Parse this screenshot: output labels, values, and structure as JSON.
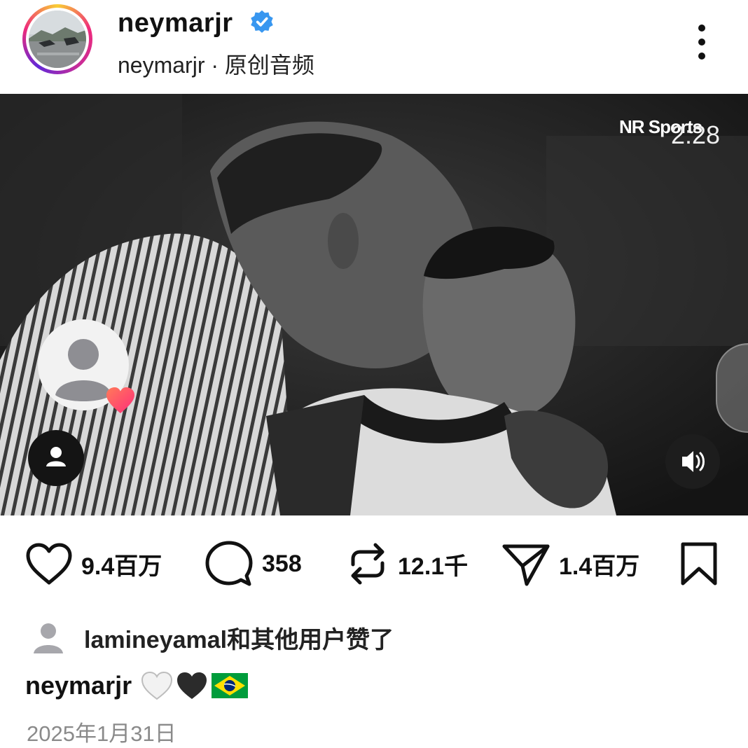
{
  "header": {
    "username": "neymarjr",
    "verified": true,
    "audio_owner": "neymarjr",
    "audio_separator": " · ",
    "audio_label": "原创音频",
    "more_icon": "more-vertical-icon"
  },
  "video": {
    "watermark": "NR Sports",
    "duration": "2:28",
    "tag_icon": "user-tag-icon",
    "sound_icon": "speaker-icon"
  },
  "actions": {
    "likes": "9.4百万",
    "comments": "358",
    "reposts": "12.1千",
    "shares": "1.4百万"
  },
  "liked_by": {
    "text": "lamineyamal和其他用户赞了"
  },
  "caption": {
    "username": "neymarjr",
    "emojis": [
      "white-heart",
      "black-heart",
      "brazil-flag"
    ]
  },
  "post_date": "2025年1月31日",
  "colors": {
    "verified_blue": "#3897f0",
    "heart_pink": "#ff3b6b",
    "brazil_green": "#009c3b",
    "brazil_yellow": "#ffdf00",
    "brazil_blue": "#002776"
  }
}
